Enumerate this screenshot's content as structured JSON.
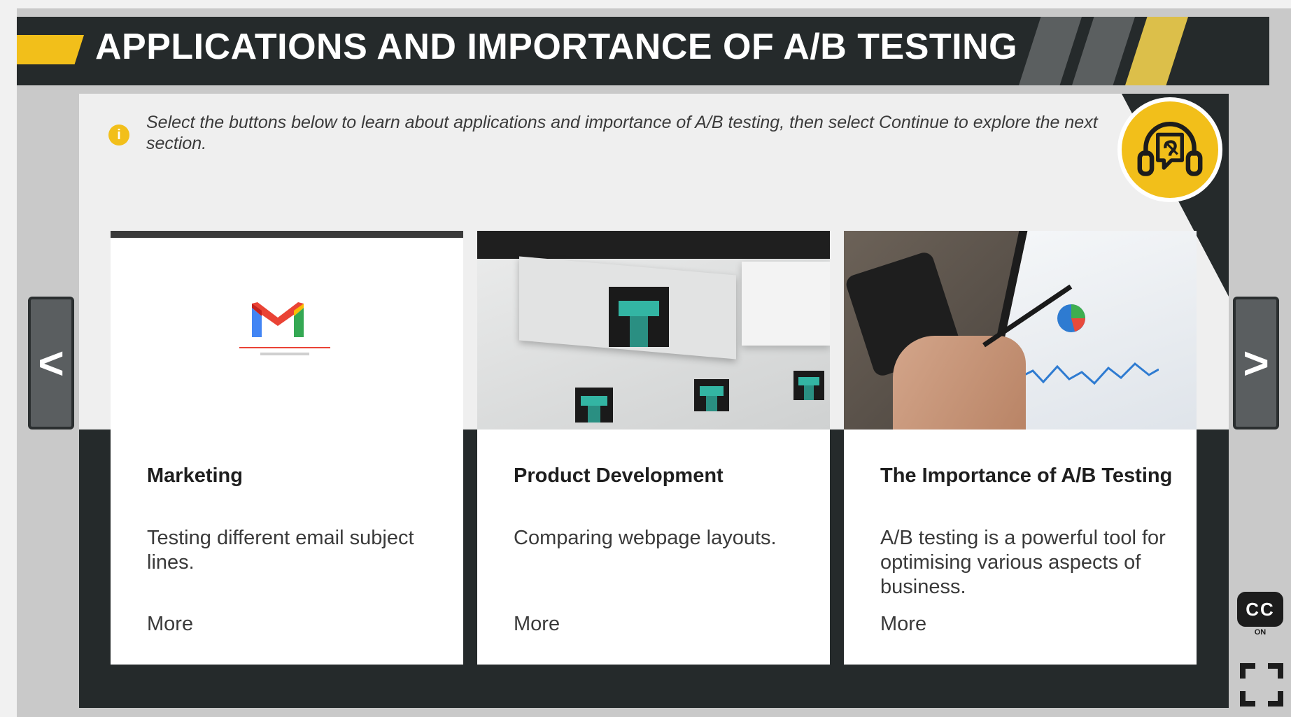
{
  "header": {
    "title": "APPLICATIONS AND IMPORTANCE OF A/B TESTING"
  },
  "instruction": {
    "icon": "info-icon",
    "info_glyph": "i",
    "text": "Select the buttons below to learn about applications and importance of A/B testing, then select Continue to explore the next section."
  },
  "audio": {
    "icon": "headphones-icon"
  },
  "cards": [
    {
      "title": "Marketing",
      "description": "Testing different email subject lines.",
      "more": "More",
      "image": "gmail-loading-screenshot"
    },
    {
      "title": "Product Development",
      "description": "Comparing webpage layouts.",
      "more": "More",
      "image": "webpage-layouts-screenshot"
    },
    {
      "title": "The Importance of A/B Testing",
      "description": "A/B testing is a powerful tool for optimising various aspects of business.",
      "more": "More",
      "image": "tablet-analytics-photo"
    }
  ],
  "nav": {
    "prev_label": "<",
    "next_label": ">"
  },
  "captions": {
    "label": "CC",
    "state": "ON"
  },
  "colors": {
    "accent": "#f2bf1a",
    "dark": "#252a2b",
    "panel": "#efefef"
  }
}
